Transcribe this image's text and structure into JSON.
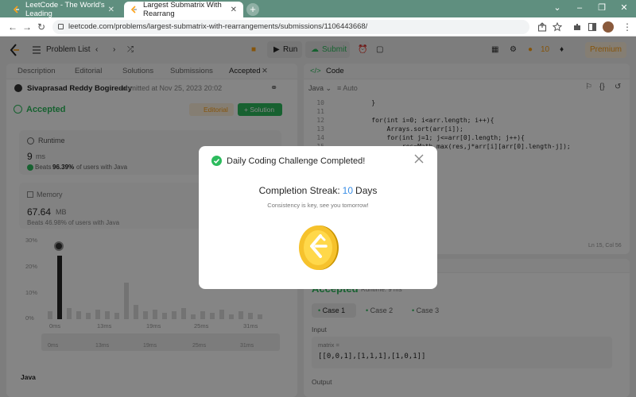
{
  "browser": {
    "tabs": [
      {
        "title": "LeetCode - The World's Leading",
        "active": false
      },
      {
        "title": "Largest Submatrix With Rearrang",
        "active": true
      }
    ],
    "url": "leetcode.com/problems/largest-submatrix-with-rearrangements/submissions/1106443668/"
  },
  "topbar": {
    "problem_list": "Problem List",
    "run": "Run",
    "submit": "Submit",
    "streak_count": "10",
    "premium": "Premium"
  },
  "left_panel": {
    "tabs": [
      "Description",
      "Editorial",
      "Solutions",
      "Submissions",
      "Accepted"
    ],
    "user": "Sivaprasad Reddy Bogireddy",
    "submitted_text": "submitted at Nov 25, 2023 20:02",
    "status": "Accepted",
    "editorial_btn": "Editorial",
    "solution_btn": "Solution",
    "runtime_label": "Runtime",
    "runtime_value": "9",
    "runtime_unit": "ms",
    "runtime_beats_prefix": "Beats",
    "runtime_beats_pct": "96.39%",
    "runtime_beats_suffix": "of users with Java",
    "memory_label": "Memory",
    "memory_value": "67.64",
    "memory_unit": "MB",
    "memory_beats": "Beats 46.98% of users with Java",
    "y_ticks": [
      "30%",
      "20%",
      "10%",
      "0%"
    ],
    "x_ticks": [
      "0ms",
      "13ms",
      "19ms",
      "25ms",
      "31ms"
    ],
    "x_ticks2": [
      "0ms",
      "13ms",
      "19ms",
      "25ms",
      "31ms"
    ],
    "lang_label": "Java"
  },
  "right_panel": {
    "code_title": "Code",
    "language": "Java",
    "autosave": "Auto",
    "lines": [
      {
        "n": "10",
        "t": "    }"
      },
      {
        "n": "11",
        "t": ""
      },
      {
        "n": "12",
        "t": "    for(int i=0; i<arr.length; i++){"
      },
      {
        "n": "13",
        "t": "        Arrays.sort(arr[i]);"
      },
      {
        "n": "14",
        "t": "        for(int j=1; j<=arr[0].length; j++){"
      },
      {
        "n": "15",
        "t": "            res=Math.max(res,j*arr[i][arr[0].length-j]);"
      }
    ],
    "cursor_pos": "Ln 15, Col 56",
    "result_status": "Accepted",
    "result_runtime": "Runtime: 9 ms",
    "cases": [
      "Case 1",
      "Case 2",
      "Case 3"
    ],
    "input_label": "Input",
    "matrix_label": "matrix =",
    "matrix_value": "[[0,0,1],[1,1,1],[1,0,1]]",
    "output_label": "Output"
  },
  "modal": {
    "title": "Daily Coding Challenge Completed!",
    "streak_label": "Completion Streak:",
    "streak_value": "10",
    "streak_unit": "Days",
    "message": "Consistency is key, see you tomorrow!"
  },
  "colors": {
    "accent_green": "#2cbb5d",
    "brand_orange": "#ffa116",
    "streak_blue": "#3a8ee6",
    "chrome_green": "#5f8f7f"
  }
}
